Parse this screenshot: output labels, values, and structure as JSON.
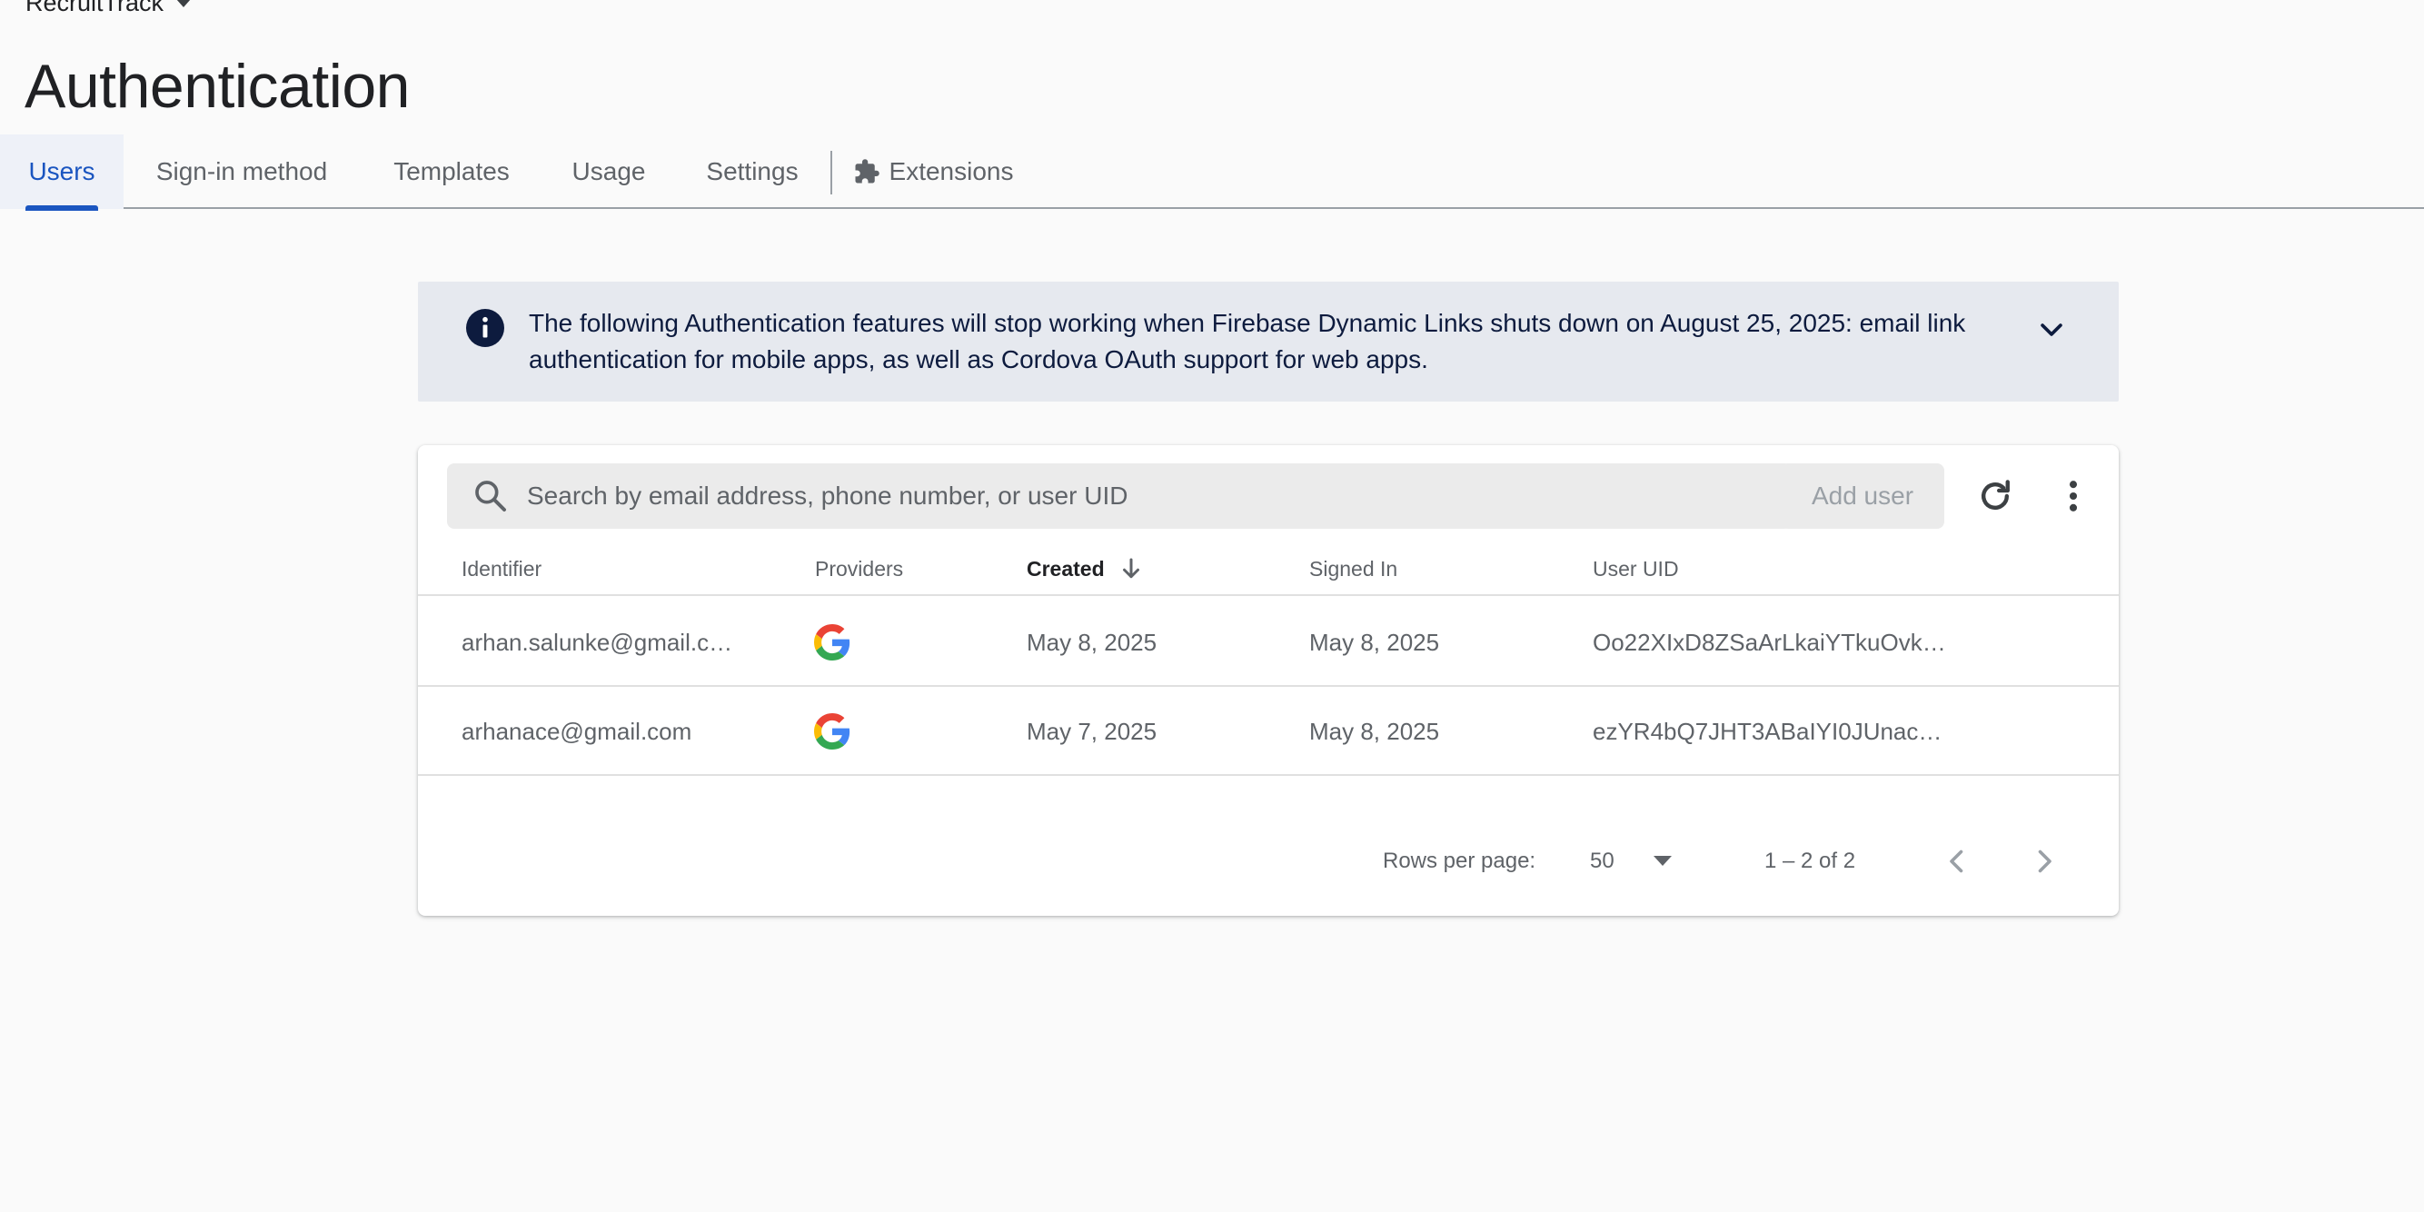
{
  "project": {
    "name": "RecruitTrack",
    "dropdown_icon": "caret-down-icon"
  },
  "page": {
    "title": "Authentication"
  },
  "tabs": [
    {
      "label": "Users",
      "active": true
    },
    {
      "label": "Sign-in method",
      "active": false
    },
    {
      "label": "Templates",
      "active": false
    },
    {
      "label": "Usage",
      "active": false
    },
    {
      "label": "Settings",
      "active": false
    },
    {
      "label": "Extensions",
      "active": false,
      "icon": "puzzle-piece-icon"
    }
  ],
  "banner": {
    "icon": "info-icon",
    "text": "The following Authentication features will stop working when Firebase Dynamic Links shuts down on August 25, 2025: email link authentication for mobile apps, as well as Cordova OAuth support for web apps.",
    "expand_icon": "chevron-down-icon"
  },
  "toolbar": {
    "search_placeholder": "Search by email address, phone number, or user UID",
    "search_icon": "search-icon",
    "add_user_label": "Add user",
    "refresh_icon": "refresh-icon",
    "more_icon": "more-vert-icon"
  },
  "table": {
    "columns": [
      "Identifier",
      "Providers",
      "Created",
      "Signed In",
      "User UID"
    ],
    "sorted_column": "Created",
    "sort_direction": "descending",
    "rows": [
      {
        "identifier": "arhan.salunke@gmail.c…",
        "provider": "google",
        "created": "May 8, 2025",
        "signed_in": "May 8, 2025",
        "uid": "Oo22XIxD8ZSaArLkaiYTkuOvk…"
      },
      {
        "identifier": "arhanace@gmail.com",
        "provider": "google",
        "created": "May 7, 2025",
        "signed_in": "May 8, 2025",
        "uid": "ezYR4bQ7JHT3ABaIYI0JUnac…"
      }
    ]
  },
  "pagination": {
    "rows_per_page_label": "Rows per page:",
    "rows_per_page_value": "50",
    "range_text": "1 – 2 of 2"
  },
  "colors": {
    "accent": "#1a55c0",
    "banner_bg": "#e6e9ef",
    "banner_text": "#0d1b3e",
    "page_bg": "#fafafa"
  }
}
